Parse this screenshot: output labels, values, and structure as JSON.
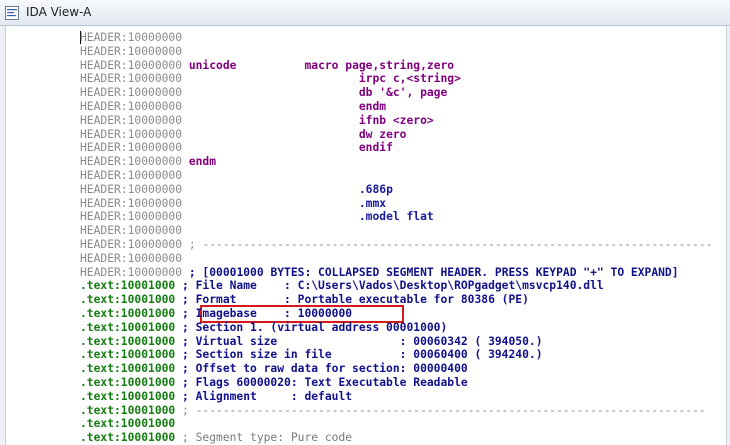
{
  "window": {
    "title": "IDA View-A"
  },
  "lines": [
    {
      "addr": "HEADER:10000000",
      "kind": "header",
      "parts": []
    },
    {
      "addr": "HEADER:10000000",
      "kind": "header",
      "parts": []
    },
    {
      "addr": "HEADER:10000000",
      "kind": "header",
      "parts": [
        {
          "text": " unicode",
          "cls": "c-kw"
        },
        {
          "text": "          macro page,string,zero",
          "cls": "c-kw"
        }
      ]
    },
    {
      "addr": "HEADER:10000000",
      "kind": "header",
      "parts": [
        {
          "text": "                          irpc c,<string>",
          "cls": "c-kw"
        }
      ]
    },
    {
      "addr": "HEADER:10000000",
      "kind": "header",
      "parts": [
        {
          "text": "                          db '&c', page",
          "cls": "c-kw"
        }
      ]
    },
    {
      "addr": "HEADER:10000000",
      "kind": "header",
      "parts": [
        {
          "text": "                          endm",
          "cls": "c-kw"
        }
      ]
    },
    {
      "addr": "HEADER:10000000",
      "kind": "header",
      "parts": [
        {
          "text": "                          ifnb <zero>",
          "cls": "c-kw"
        }
      ]
    },
    {
      "addr": "HEADER:10000000",
      "kind": "header",
      "parts": [
        {
          "text": "                          dw zero",
          "cls": "c-kw"
        }
      ]
    },
    {
      "addr": "HEADER:10000000",
      "kind": "header",
      "parts": [
        {
          "text": "                          endif",
          "cls": "c-kw"
        }
      ]
    },
    {
      "addr": "HEADER:10000000",
      "kind": "header",
      "parts": [
        {
          "text": " endm",
          "cls": "c-kw"
        }
      ]
    },
    {
      "addr": "HEADER:10000000",
      "kind": "header",
      "parts": []
    },
    {
      "addr": "HEADER:10000000",
      "kind": "header",
      "parts": [
        {
          "text": "                          .686p",
          "cls": "c-code"
        }
      ]
    },
    {
      "addr": "HEADER:10000000",
      "kind": "header",
      "parts": [
        {
          "text": "                          .mmx",
          "cls": "c-code"
        }
      ]
    },
    {
      "addr": "HEADER:10000000",
      "kind": "header",
      "parts": [
        {
          "text": "                          .model flat",
          "cls": "c-code"
        }
      ]
    },
    {
      "addr": "HEADER:10000000",
      "kind": "header",
      "parts": []
    },
    {
      "addr": "HEADER:10000000",
      "kind": "header",
      "parts": [
        {
          "text": " ; ---------------------------------------------------------------------------",
          "cls": "c-sep"
        }
      ]
    },
    {
      "addr": "HEADER:10000000",
      "kind": "header",
      "parts": []
    },
    {
      "addr": "HEADER:10000000",
      "kind": "header",
      "parts": [
        {
          "text": " ; [00001000 BYTES: COLLAPSED SEGMENT HEADER. PRESS KEYPAD \"+\" TO EXPAND]",
          "cls": "c-comment"
        }
      ]
    },
    {
      "addr": ".text:10001000",
      "kind": "text",
      "parts": [
        {
          "text": " ; File Name    : C:\\Users\\Vados\\Desktop\\ROPgadget\\msvcp140.dll",
          "cls": "c-comment"
        }
      ]
    },
    {
      "addr": ".text:10001000",
      "kind": "text",
      "parts": [
        {
          "text": " ; Format       : Portable executable for 80386 (PE)",
          "cls": "c-comment"
        }
      ]
    },
    {
      "addr": ".text:10001000",
      "kind": "text",
      "parts": [
        {
          "text": " ; Imagebase    : 10000000",
          "cls": "c-comment"
        }
      ]
    },
    {
      "addr": ".text:10001000",
      "kind": "text",
      "parts": [
        {
          "text": " ; Section 1. (virtual address 00001000)",
          "cls": "c-comment"
        }
      ]
    },
    {
      "addr": ".text:10001000",
      "kind": "text",
      "parts": [
        {
          "text": " ; Virtual size                  : 00060342 ( 394050.)",
          "cls": "c-comment"
        }
      ]
    },
    {
      "addr": ".text:10001000",
      "kind": "text",
      "parts": [
        {
          "text": " ; Section size in file          : 00060400 ( 394240.)",
          "cls": "c-comment"
        }
      ]
    },
    {
      "addr": ".text:10001000",
      "kind": "text",
      "parts": [
        {
          "text": " ; Offset to raw data for section: 00000400",
          "cls": "c-comment"
        }
      ]
    },
    {
      "addr": ".text:10001000",
      "kind": "text",
      "parts": [
        {
          "text": " ; Flags 60000020: Text Executable Readable",
          "cls": "c-comment"
        }
      ]
    },
    {
      "addr": ".text:10001000",
      "kind": "text",
      "parts": [
        {
          "text": " ; Alignment     : default",
          "cls": "c-comment"
        }
      ]
    },
    {
      "addr": ".text:10001000",
      "kind": "text",
      "parts": [
        {
          "text": " ; ---------------------------------------------------------------------------",
          "cls": "c-sep"
        }
      ]
    },
    {
      "addr": ".text:10001000",
      "kind": "text",
      "parts": []
    },
    {
      "addr": ".text:10001000",
      "kind": "text",
      "parts": [
        {
          "text": " ; Segment type: Pure code",
          "cls": "c-grey"
        }
      ]
    }
  ],
  "colors": {
    "header_address": "#8a8a8a",
    "text_address": "#157d11",
    "macro": "#800080",
    "directive": "#1a1aa0",
    "comment": "#10108c",
    "highlight": "#d41a1a"
  }
}
